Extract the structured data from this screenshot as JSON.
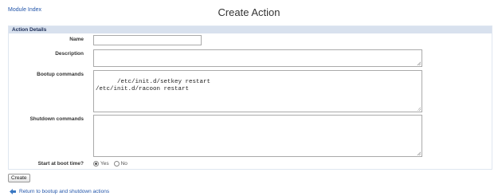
{
  "header": {
    "module_index_label": "Module Index",
    "title": "Create Action"
  },
  "section": {
    "title": "Action Details"
  },
  "form": {
    "name": {
      "label": "Name",
      "value": ""
    },
    "description": {
      "label": "Description",
      "value": ""
    },
    "bootup": {
      "label": "Bootup commands",
      "value": "/etc/init.d/setkey restart\n/etc/init.d/racoon restart"
    },
    "shutdown": {
      "label": "Shutdown commands",
      "value": ""
    },
    "start_at_boot": {
      "label": "Start at boot time?",
      "options": [
        "Yes",
        "No"
      ],
      "selected": "Yes"
    }
  },
  "actions": {
    "create_label": "Create"
  },
  "footer": {
    "return_label": "Return to bootup and shutdown actions",
    "return_icon": "left-arrow-icon"
  },
  "colors": {
    "link": "#2255aa",
    "section_header_bg": "#d8e1ee",
    "section_header_text": "#1a2b55"
  }
}
